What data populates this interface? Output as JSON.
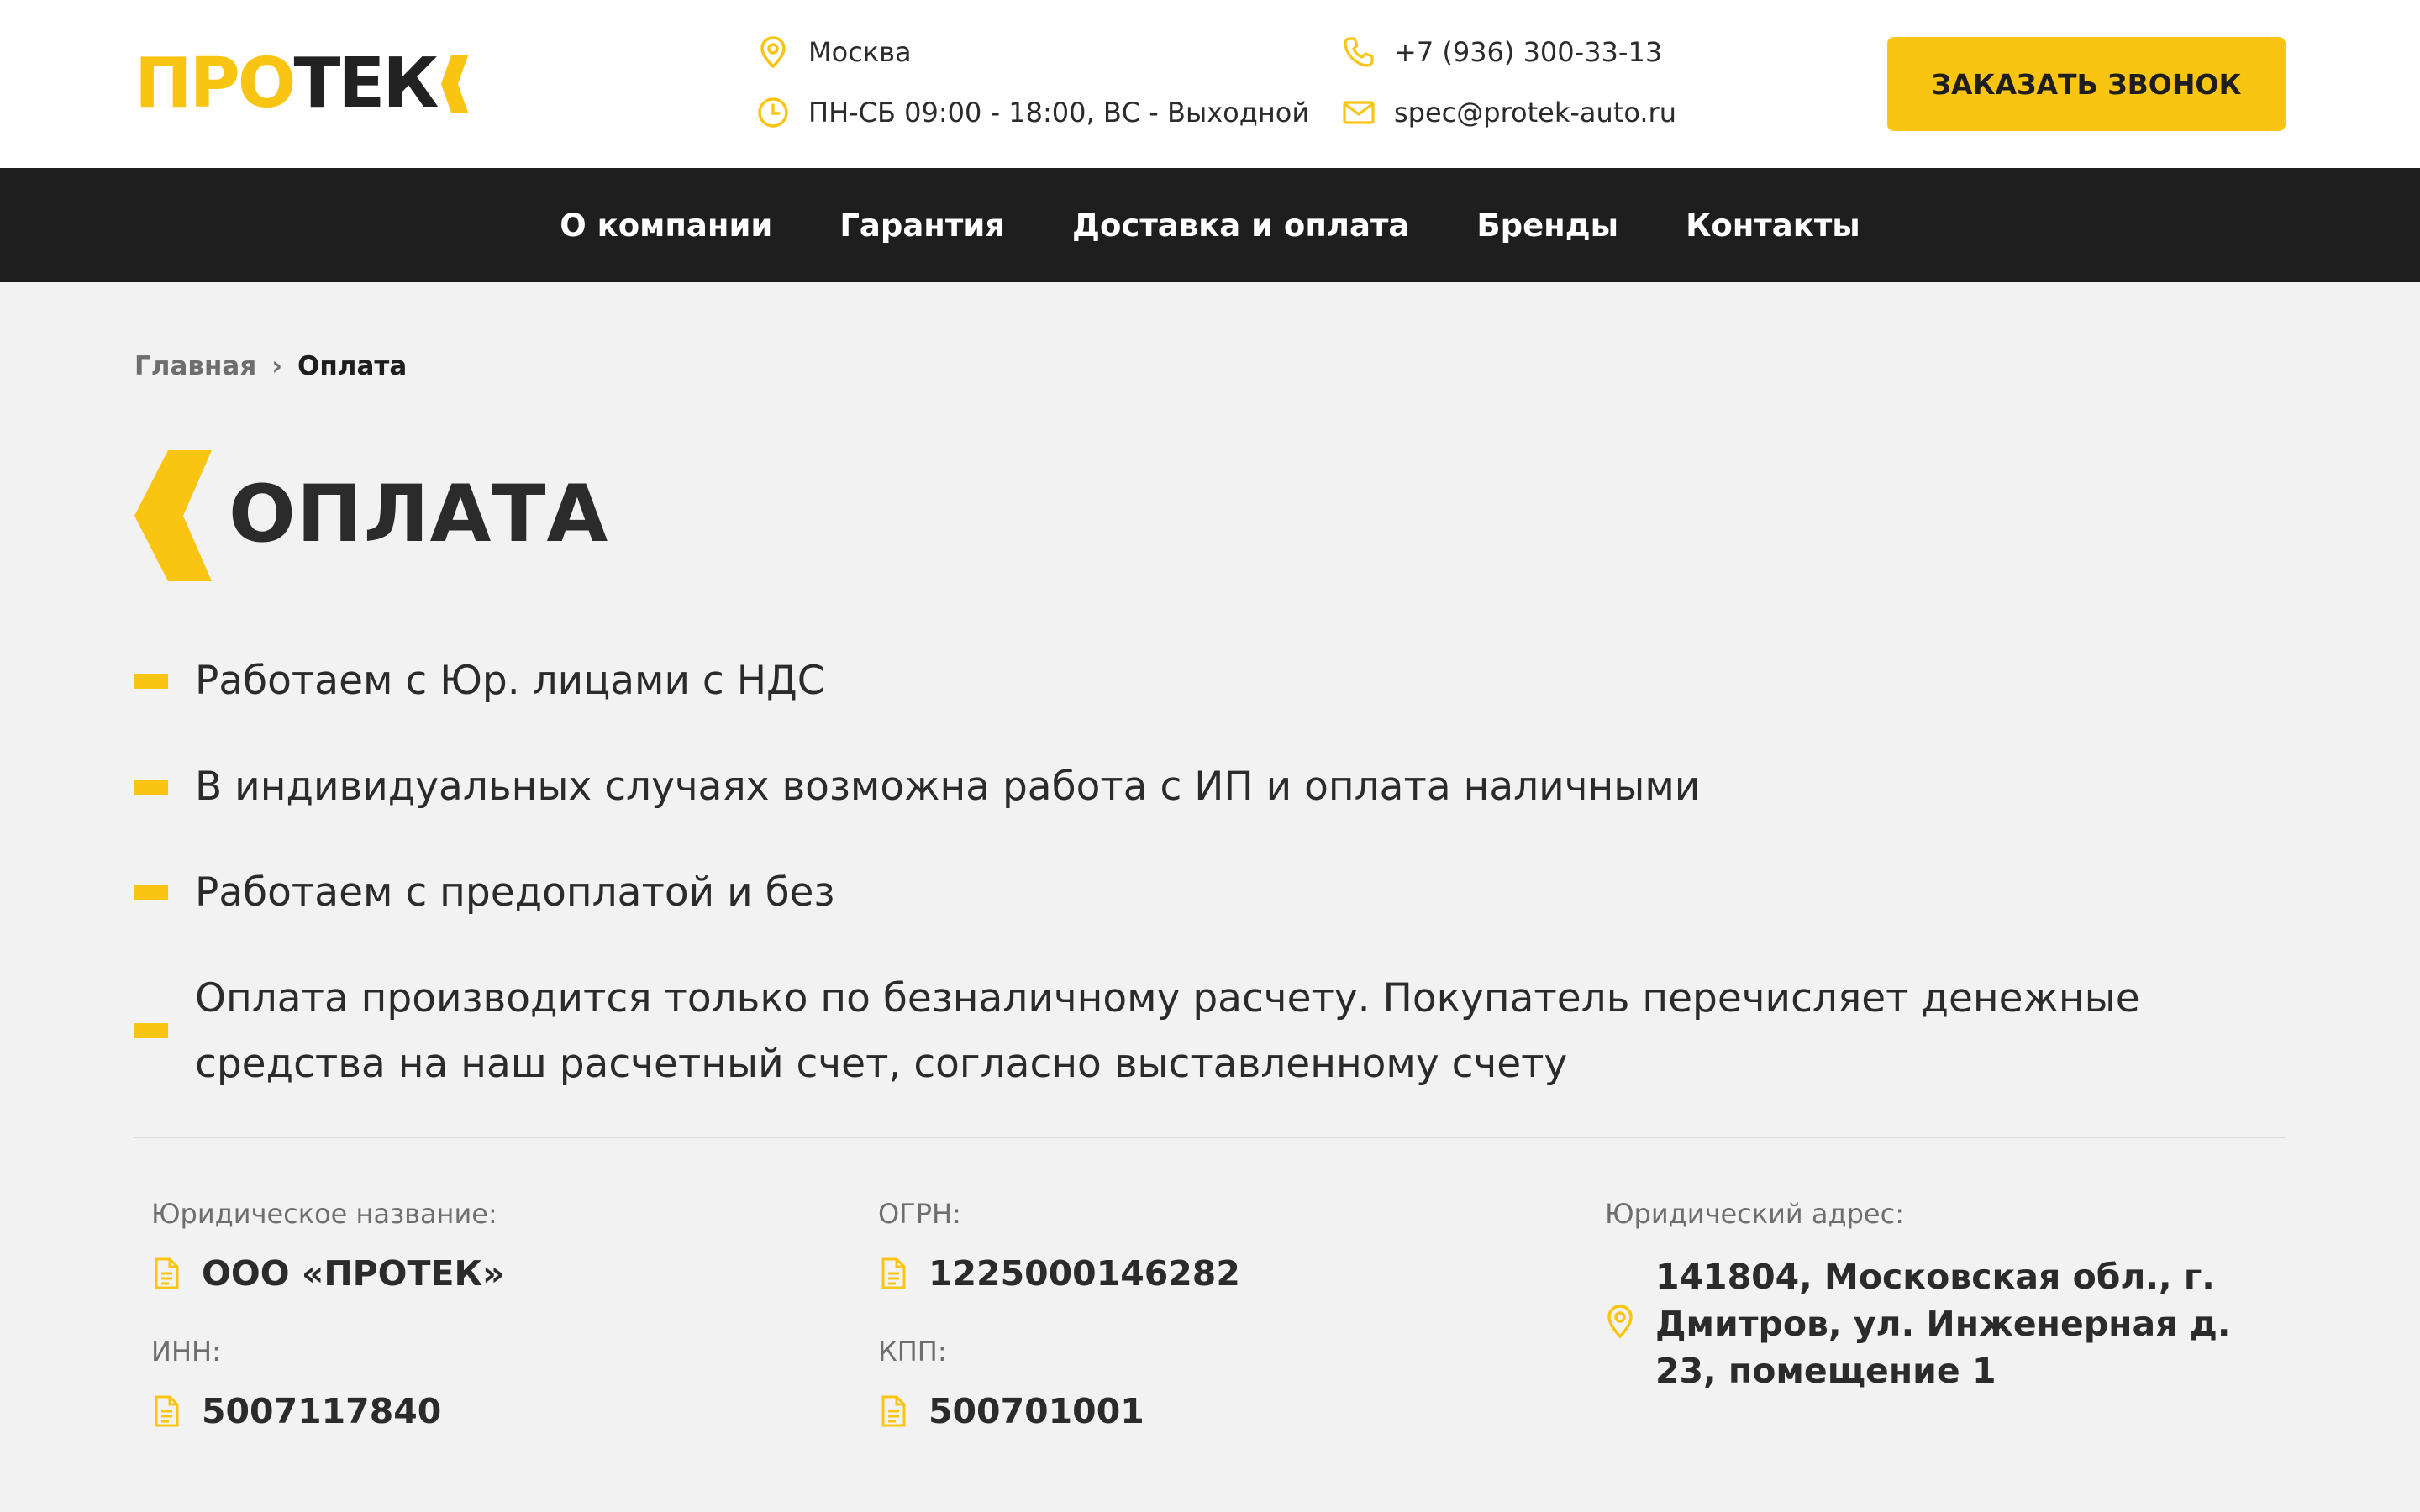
{
  "brand": {
    "logo_part1": "ПРО",
    "logo_part2": "ТЕК",
    "accent_color": "#f9c512",
    "dark_color": "#1e1e1e"
  },
  "header": {
    "city": "Москва",
    "hours": "ПН-СБ 09:00 - 18:00, ВС - Выходной",
    "phone": "+7 (936) 300-33-13",
    "email": "spec@protek-auto.ru",
    "cta_label": "ЗАКАЗАТЬ ЗВОНОК",
    "icons": [
      "location-pin-icon",
      "clock-icon",
      "phone-icon",
      "mail-icon"
    ]
  },
  "nav": {
    "items": [
      {
        "label": "О компании"
      },
      {
        "label": "Гарантия"
      },
      {
        "label": "Доставка и оплата"
      },
      {
        "label": "Бренды"
      },
      {
        "label": "Контакты"
      }
    ]
  },
  "breadcrumb": {
    "home": "Главная",
    "separator": "›",
    "current": "Оплата"
  },
  "main": {
    "title": "ОПЛАТА",
    "bullets": [
      "Работаем с Юр. лицами с НДС",
      "В индивидуальных случаях возможна работа с ИП и оплата наличными",
      "Работаем с предоплатой и без",
      "Оплата производится только по безналичному расчету. Покупатель перечисляет денежные средства на наш расчетный счет, согласно выставленному счету"
    ]
  },
  "legal": {
    "name_label": "Юридическое название:",
    "name_value": "ООО «ПРОТЕК»",
    "inn_label": "ИНН:",
    "inn_value": "5007117840",
    "ogrn_label": "ОГРН:",
    "ogrn_value": "1225000146282",
    "kpp_label": "КПП:",
    "kpp_value": "500701001",
    "address_label": "Юридический адрес:",
    "address_value": "141804, Московская обл., г. Дмитров, ул. Инженерная д. 23, помещение 1",
    "icons": [
      "document-icon",
      "location-pin-icon"
    ]
  }
}
